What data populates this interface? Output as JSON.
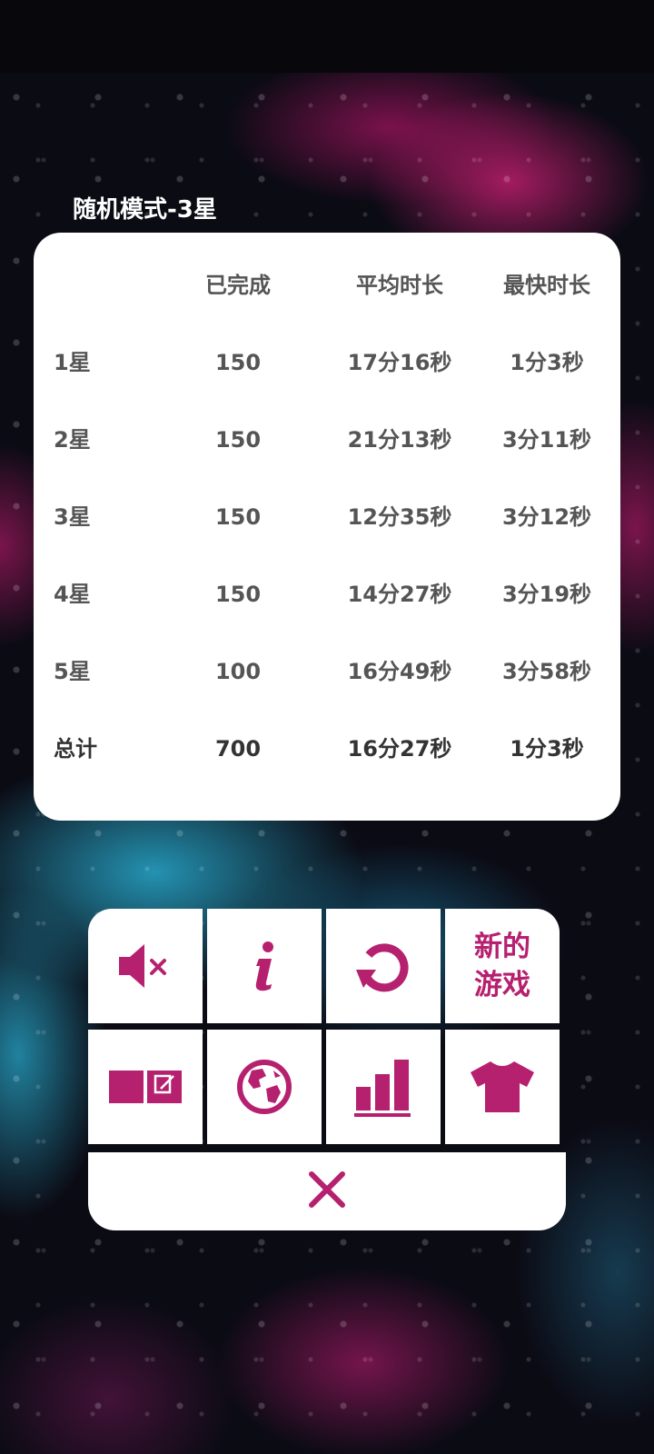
{
  "title": "随机模式-3星",
  "table": {
    "headers": [
      "",
      "已完成",
      "平均时长",
      "最快时长"
    ],
    "rows": [
      {
        "label": "1星",
        "completed": "150",
        "avg": "17分16秒",
        "best": "1分3秒"
      },
      {
        "label": "2星",
        "completed": "150",
        "avg": "21分13秒",
        "best": "3分11秒"
      },
      {
        "label": "3星",
        "completed": "150",
        "avg": "12分35秒",
        "best": "3分12秒"
      },
      {
        "label": "4星",
        "completed": "150",
        "avg": "14分27秒",
        "best": "3分19秒"
      },
      {
        "label": "5星",
        "completed": "100",
        "avg": "16分49秒",
        "best": "3分58秒"
      }
    ],
    "total": {
      "label": "总计",
      "completed": "700",
      "avg": "16分27秒",
      "best": "1分3秒"
    }
  },
  "menu": {
    "new_game_label": "新的游戏",
    "icons": [
      "mute-icon",
      "info-icon",
      "restart-icon",
      "notes-icon",
      "globe-icon",
      "stats-icon",
      "shirt-icon",
      "close-icon"
    ]
  },
  "colors": {
    "accent": "#b6216f",
    "card": "#ffffff",
    "text": "#555555"
  }
}
